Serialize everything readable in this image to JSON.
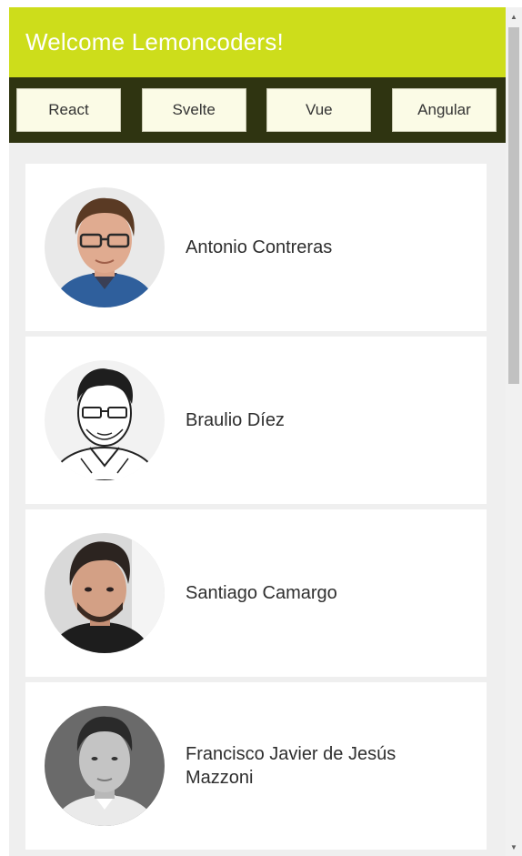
{
  "header": {
    "title": "Welcome Lemoncoders!"
  },
  "nav": {
    "buttons": [
      {
        "label": "React"
      },
      {
        "label": "Svelte"
      },
      {
        "label": "Vue"
      },
      {
        "label": "Angular"
      }
    ]
  },
  "members": [
    {
      "name": "Antonio Contreras"
    },
    {
      "name": "Braulio Díez"
    },
    {
      "name": "Santiago Camargo"
    },
    {
      "name": "Francisco Javier de Jesús Mazzoni"
    }
  ],
  "colors": {
    "header_bg": "#cddd1b",
    "nav_bg": "#2f3411",
    "button_bg": "#fbfbe6",
    "page_bg": "#efefef"
  },
  "icons": {
    "scroll_up": "scroll-up-arrow-icon",
    "scroll_down": "scroll-down-arrow-icon"
  }
}
